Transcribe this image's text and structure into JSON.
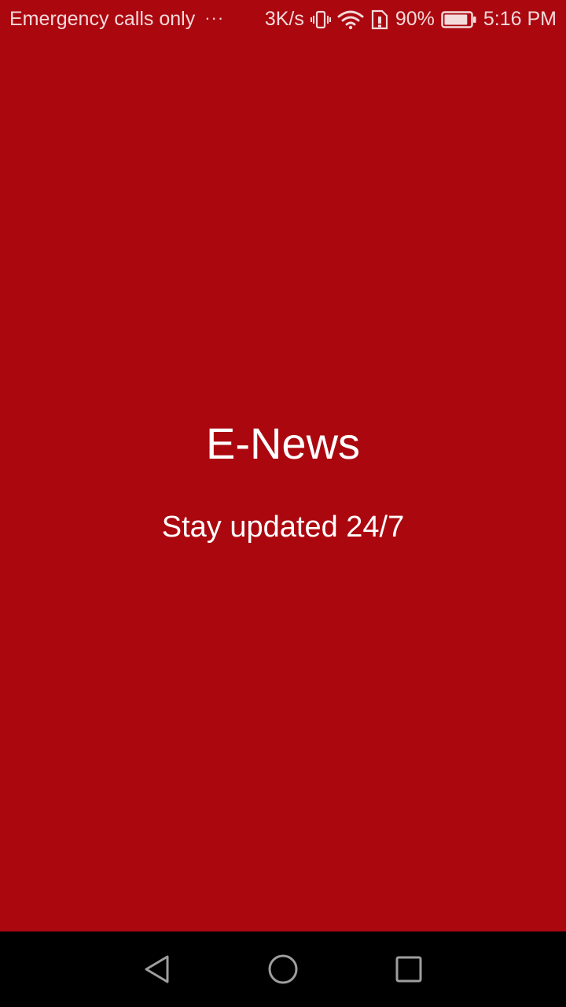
{
  "status_bar": {
    "carrier_text": "Emergency calls only",
    "more_indicator": "···",
    "network_speed": "3K/s",
    "battery_percent": "90%",
    "time": "5:16 PM",
    "icons": [
      "vibrate-icon",
      "wifi-icon",
      "sim-alert-icon",
      "battery-icon"
    ],
    "battery_level": 0.9
  },
  "splash": {
    "title": "E-News",
    "tagline": "Stay updated 24/7",
    "background_color": "#ab070f",
    "text_color": "#ffffff"
  },
  "nav_bar": {
    "buttons": [
      "back-icon",
      "home-icon",
      "recents-icon"
    ],
    "background_color": "#000000"
  }
}
